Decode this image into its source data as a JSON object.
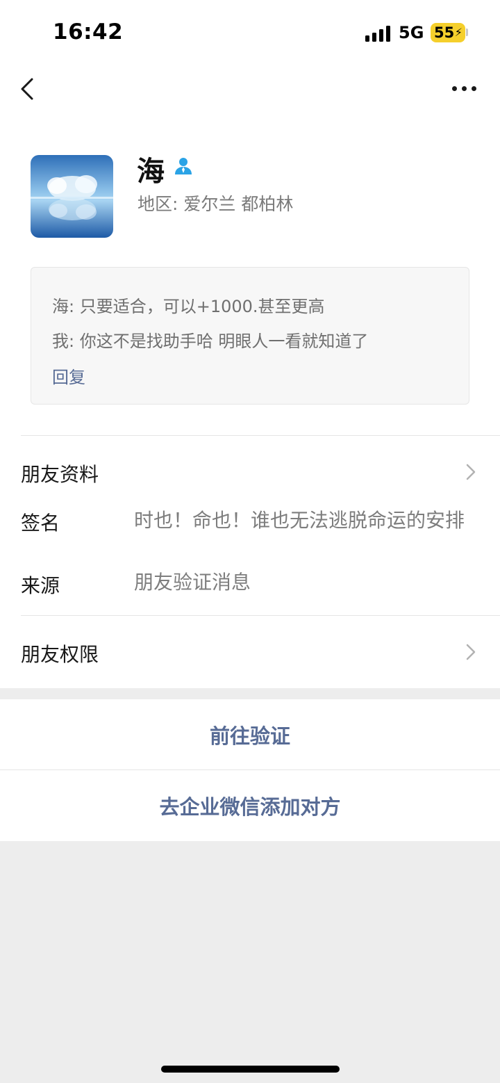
{
  "status_bar": {
    "time": "16:42",
    "network": "5G",
    "battery": "55"
  },
  "nav": {
    "back_icon": "chevron-left-icon",
    "more_icon": "more-dots-icon"
  },
  "profile": {
    "name": "海",
    "region": "地区: 爱尔兰 都柏林",
    "friend_icon": "person-icon",
    "avatar_icon": "frosted-trees-lake-image"
  },
  "message_box": {
    "line1": "海: 只要适合，可以+1000.甚至更高",
    "line2": "我: 你这不是找助手哈 明眼人一看就知道了",
    "reply_label": "回复"
  },
  "rows": {
    "friend_info": "朋友资料",
    "signature_label": "签名",
    "signature_value": "时也！命也！谁也无法逃脱命运的安排",
    "source_label": "来源",
    "source_value": "朋友验证消息",
    "permissions": "朋友权限"
  },
  "actions": {
    "verify": "前往验证",
    "enterprise_add": "去企业微信添加对方"
  },
  "colors": {
    "link": "#576b95",
    "background": "#ededed",
    "friend_icon": "#2aa3e6"
  }
}
